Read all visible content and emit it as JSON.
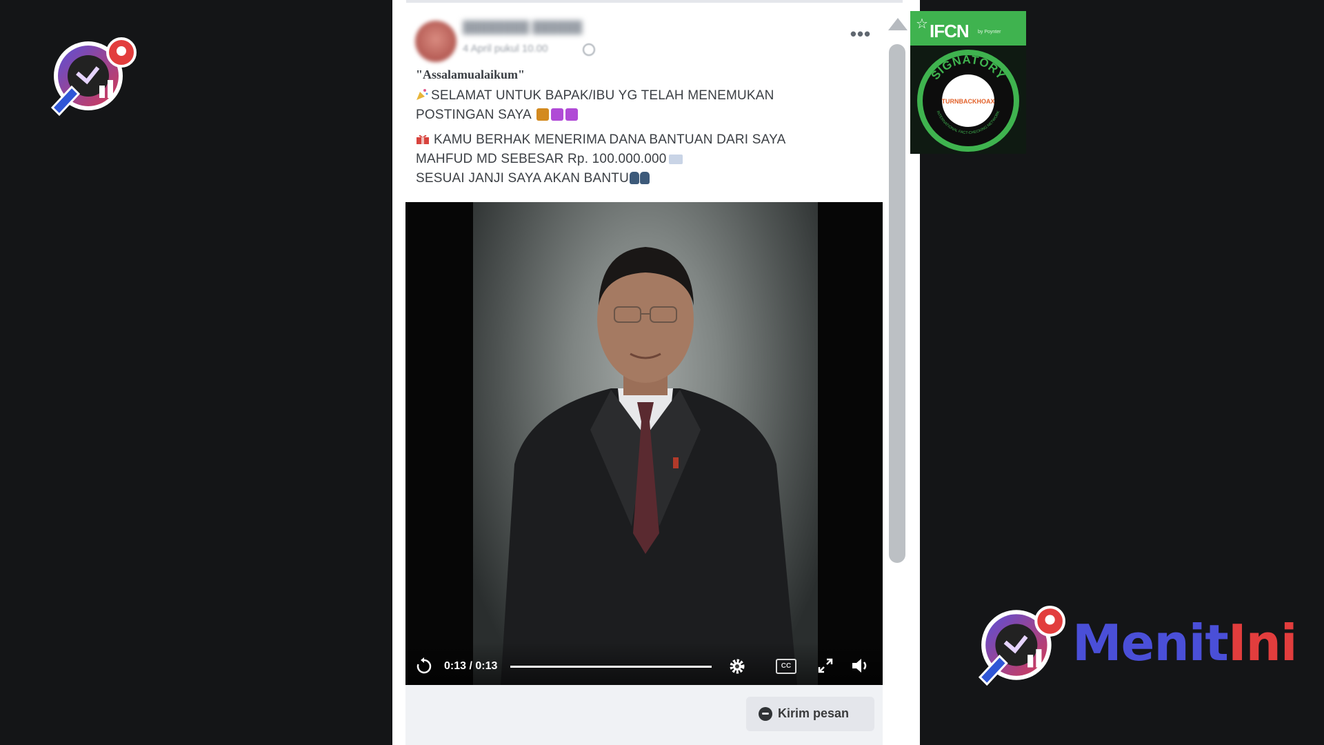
{
  "post": {
    "date": "4 April pukul 10.00",
    "greeting": "\"Assalamualaikum\"",
    "line1": "SELAMAT UNTUK BAPAK/IBU YG TELAH MENEMUKAN",
    "line2": "POSTINGAN SAYA",
    "line3": "KAMU BERHAK MENERIMA DANA BANTUAN DARI SAYA",
    "line4": "MAHFUD MD SEBESAR Rp. 100.000.000",
    "line5": "SESUAI JANJI SAYA AKAN BANTU",
    "more_label": "•••"
  },
  "video": {
    "time": "0:13 / 0:13",
    "progress": 1.0,
    "cc_label": "CC"
  },
  "actions": {
    "send_message": "Kirim pesan"
  },
  "badge": {
    "title": "IFCN",
    "subtitle": "by Poynter",
    "ring_text": "SIGNATORY",
    "ring_small": "INTERNATIONAL FACT-CHECKING NETWORK",
    "center": "TURNBACKHOAX"
  },
  "brand": {
    "name_part1": "Menit",
    "name_part2": "Ini"
  },
  "colors": {
    "page_bg": "#141517",
    "badge_green": "#3fb34f",
    "brand_blue": "#4a4fd8",
    "brand_red": "#e23d3d"
  }
}
